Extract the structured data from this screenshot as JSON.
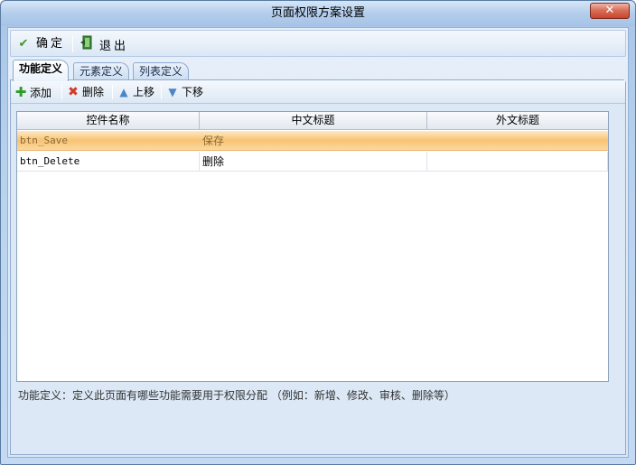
{
  "window": {
    "title": "页面权限方案设置",
    "close_label": "✕"
  },
  "toolbar": {
    "confirm_label": "确定",
    "exit_label": "退出"
  },
  "tabs": [
    {
      "label": "功能定义",
      "active": true
    },
    {
      "label": "元素定义",
      "active": false
    },
    {
      "label": "列表定义",
      "active": false
    }
  ],
  "actions": {
    "add_label": "添加",
    "delete_label": "删除",
    "move_up_label": "上移",
    "move_down_label": "下移"
  },
  "table": {
    "columns": [
      "控件名称",
      "中文标题",
      "外文标题"
    ],
    "rows": [
      {
        "control": "btn_Save",
        "cn_title": "保存",
        "foreign_title": "",
        "selected": true
      },
      {
        "control": "btn_Delete",
        "cn_title": "删除",
        "foreign_title": "",
        "selected": false
      }
    ]
  },
  "hint": "功能定义：定义此页面有哪些功能需要用于权限分配 （例如：新增、修改、审核、删除等）",
  "colors": {
    "selected_row": "#f9c374",
    "accent": "#a9c6e8"
  }
}
